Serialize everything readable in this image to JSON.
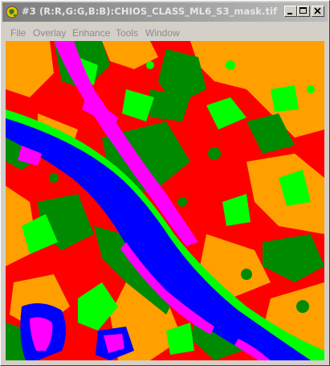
{
  "window": {
    "title": "#3 (R:R,G:G,B:B):CHIOS_CLASS_ML6_S3_mask.tif",
    "icon": "globe-icon",
    "controls": [
      "minimize-icon",
      "maximize-icon",
      "close-icon"
    ]
  },
  "menu": {
    "items": [
      {
        "label": "File"
      },
      {
        "label": "Overlay"
      },
      {
        "label": "Enhance"
      },
      {
        "label": "Tools"
      },
      {
        "label": "Window"
      }
    ]
  },
  "image": {
    "description_colors": {
      "class_red": "#ff0000",
      "class_orange": "#ff9f00",
      "class_dark_green": "#008a00",
      "class_light_green": "#00ff00",
      "class_blue": "#0000ff",
      "class_magenta": "#ff00ff"
    }
  }
}
